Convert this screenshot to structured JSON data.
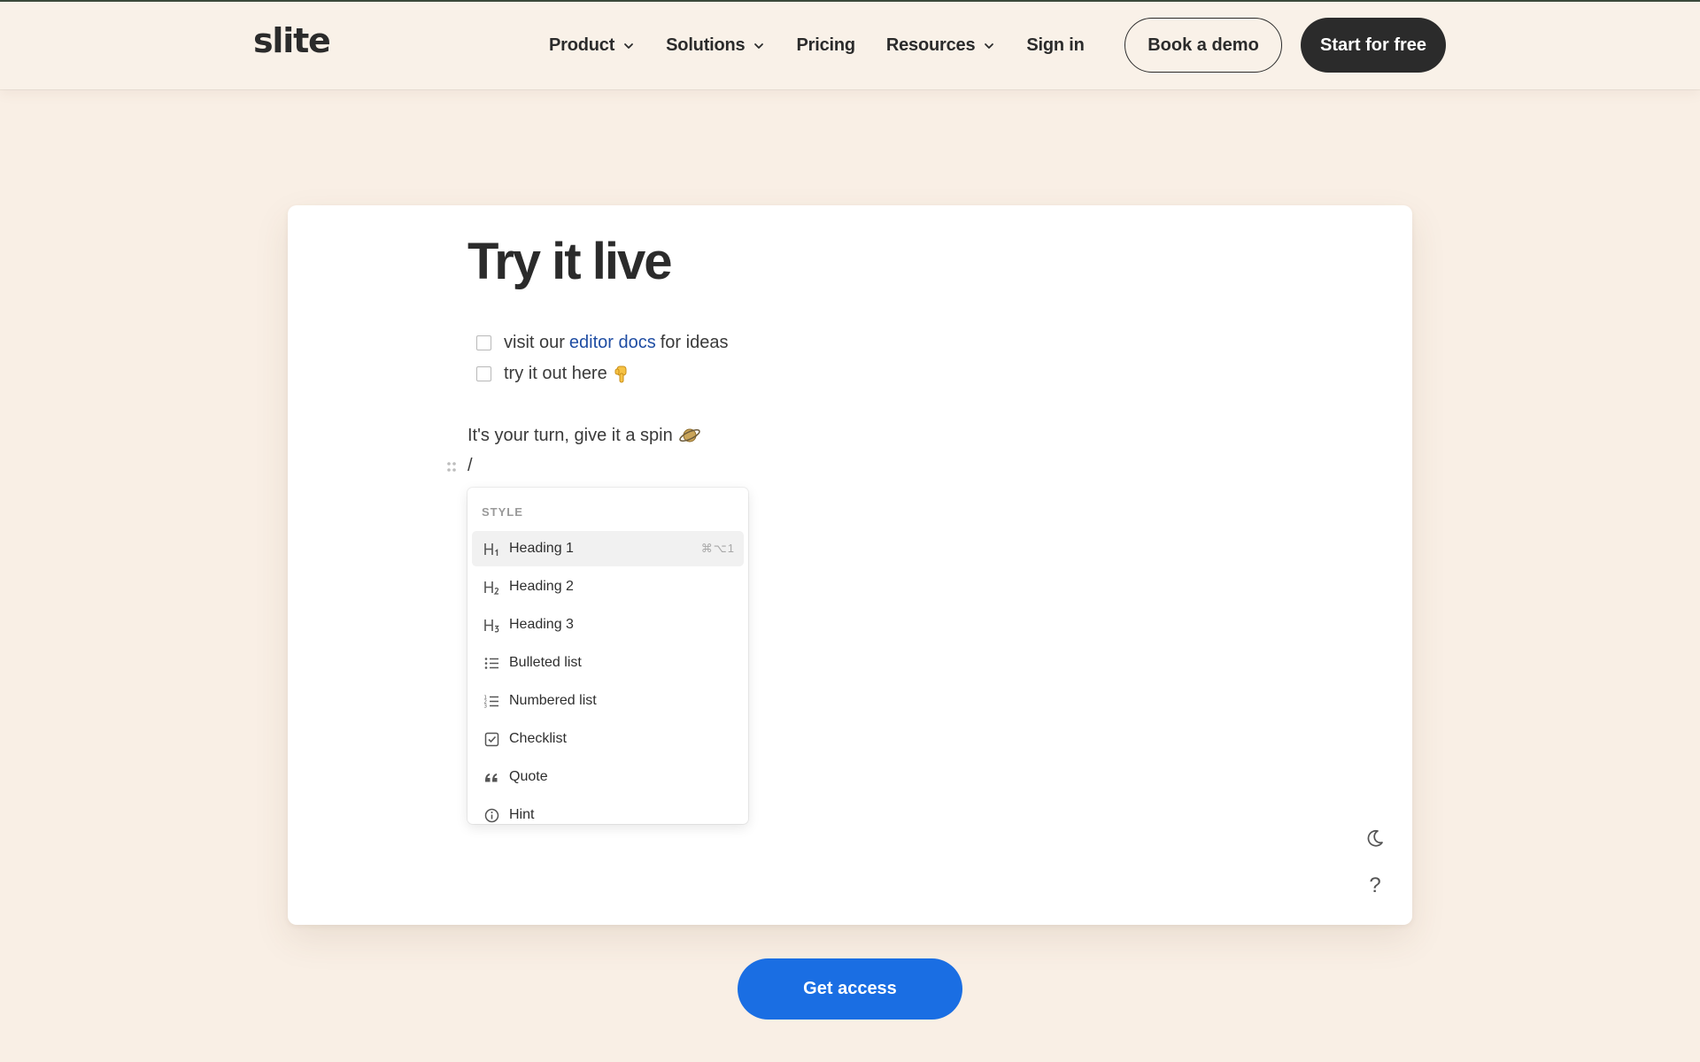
{
  "header": {
    "logo": "slite",
    "nav": [
      {
        "label": "Product",
        "dropdown": true
      },
      {
        "label": "Solutions",
        "dropdown": true
      },
      {
        "label": "Pricing",
        "dropdown": false
      },
      {
        "label": "Resources",
        "dropdown": true
      },
      {
        "label": "Sign in",
        "dropdown": false
      }
    ],
    "book_demo_label": "Book a demo",
    "start_free_label": "Start for free"
  },
  "editor": {
    "title": "Try it live",
    "checklist": [
      {
        "prefix": "visit our",
        "link": "editor docs",
        "suffix": "for ideas",
        "checked": false
      },
      {
        "text": "try it out here",
        "emoji": "pointing-down-hand",
        "checked": false
      }
    ],
    "paragraph": "It's your turn, give it a spin",
    "paragraph_emoji": "ringed-planet",
    "slash_text": "/"
  },
  "slash_menu": {
    "section": "STYLE",
    "items": [
      {
        "label": "Heading 1",
        "icon": "heading-1-icon",
        "shortcut": "⌘⌥1",
        "active": true
      },
      {
        "label": "Heading 2",
        "icon": "heading-2-icon",
        "shortcut": ""
      },
      {
        "label": "Heading 3",
        "icon": "heading-3-icon",
        "shortcut": ""
      },
      {
        "label": "Bulleted list",
        "icon": "bulleted-list-icon",
        "shortcut": ""
      },
      {
        "label": "Numbered list",
        "icon": "numbered-list-icon",
        "shortcut": ""
      },
      {
        "label": "Checklist",
        "icon": "checklist-icon",
        "shortcut": ""
      },
      {
        "label": "Quote",
        "icon": "quote-icon",
        "shortcut": ""
      },
      {
        "label": "Hint",
        "icon": "hint-icon",
        "shortcut": ""
      }
    ]
  },
  "utilities": {
    "theme_icon": "moon-icon",
    "help_text": "?"
  },
  "cta": {
    "get_access_label": "Get access"
  },
  "colors": {
    "page_bg": "#f9efe5",
    "header_bg": "#f9f1e8",
    "dark": "#2b2b2b",
    "link": "#1f4da3",
    "cta_blue": "#1a6ee3"
  }
}
